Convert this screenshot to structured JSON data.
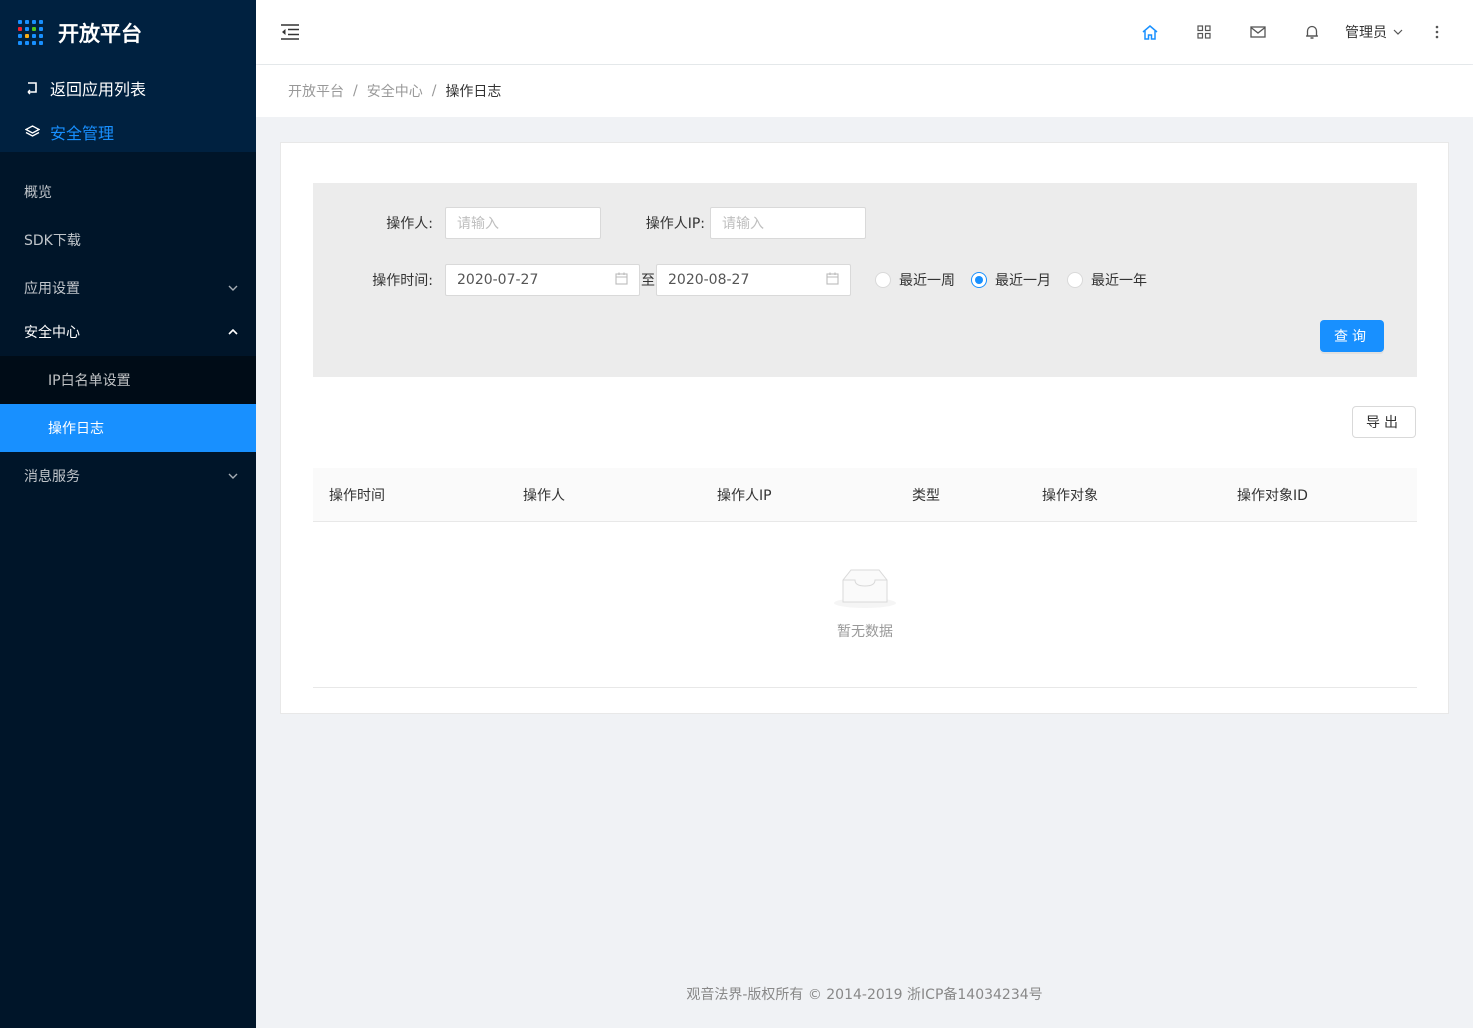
{
  "sidebar": {
    "logo_title": "开放平台",
    "back_label": "返回应用列表",
    "section_label": "安全管理",
    "menu": {
      "overview": "概览",
      "sdk": "SDK下载",
      "app_settings": "应用设置",
      "security_center": "安全中心",
      "ip_whitelist": "IP白名单设置",
      "operation_log": "操作日志",
      "message_service": "消息服务"
    }
  },
  "header": {
    "user_name": "管理员"
  },
  "breadcrumb": {
    "level1": "开放平台",
    "level2": "安全中心",
    "level3": "操作日志",
    "separator": "/"
  },
  "filter": {
    "operator_label": "操作人:",
    "operator_placeholder": "请输入",
    "operator_ip_label": "操作人IP:",
    "operator_ip_placeholder": "请输入",
    "time_label": "操作时间:",
    "start_date": "2020-07-27",
    "to_label": "至",
    "end_date": "2020-08-27",
    "radio_week": "最近一周",
    "radio_month": "最近一月",
    "radio_year": "最近一年",
    "selected_range": "最近一月",
    "query_button": "查询"
  },
  "export_button": "导出",
  "table": {
    "columns": [
      "操作时间",
      "操作人",
      "操作人IP",
      "类型",
      "操作对象",
      "操作对象ID"
    ],
    "rows": [],
    "empty_text": "暂无数据"
  },
  "footer": {
    "text": "观音法界-版权所有 © 2014-2019 浙ICP备14034234号"
  },
  "colors": {
    "primary": "#1890ff",
    "sidebar_bg": "#001529",
    "sidebar_top_bg": "#002140",
    "submenu_bg": "#000c17"
  }
}
